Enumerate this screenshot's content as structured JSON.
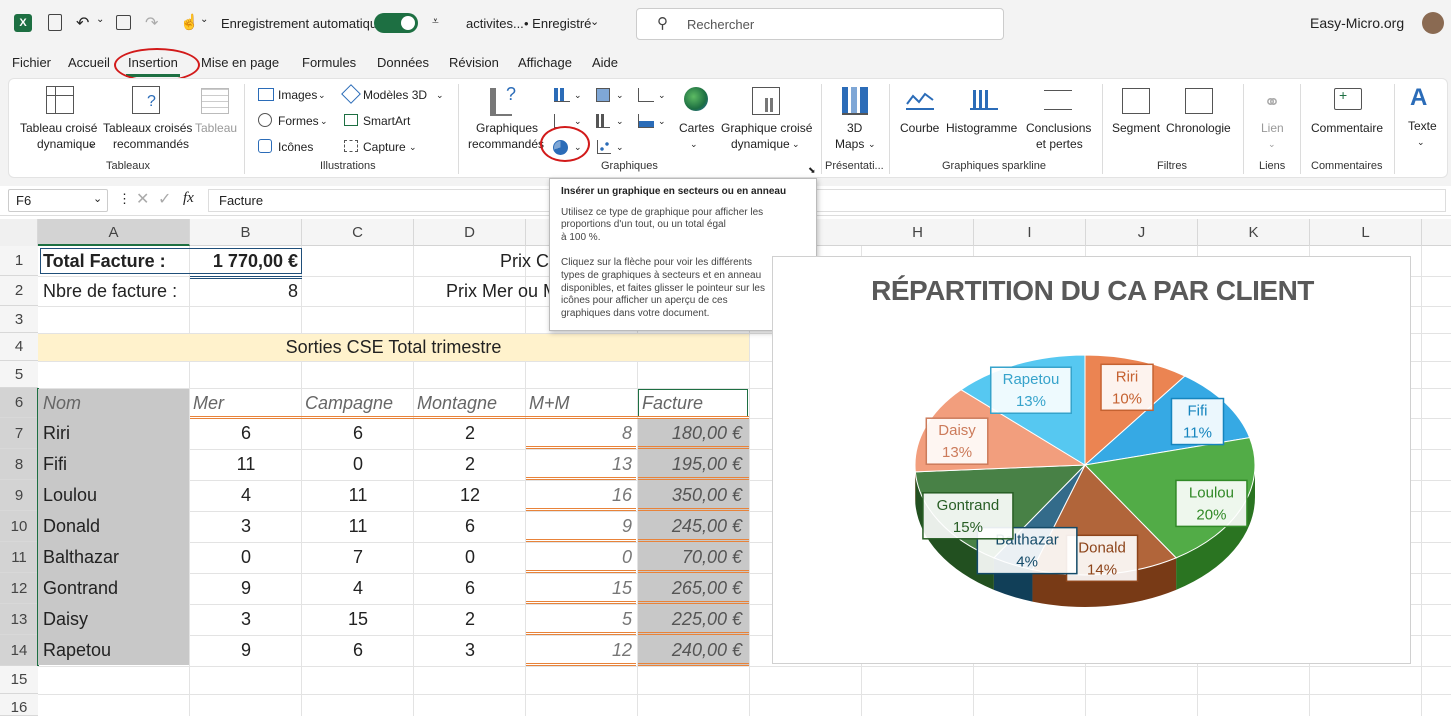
{
  "titlebar": {
    "autosave_label": "Enregistrement automatique",
    "filename": "activites...",
    "saved_status": "• Enregistré",
    "search_placeholder": "Rechercher",
    "site": "Easy-Micro.org"
  },
  "menu": [
    "Fichier",
    "Accueil",
    "Insertion",
    "Mise en page",
    "Formules",
    "Données",
    "Révision",
    "Affichage",
    "Aide"
  ],
  "ribbon": {
    "tableaux": {
      "group": "Tableaux",
      "btn1_line1": "Tableau croisé",
      "btn1_line2": "dynamique",
      "btn2_line1": "Tableaux croisés",
      "btn2_line2": "recommandés",
      "btn3": "Tableau"
    },
    "illustrations": {
      "group": "Illustrations",
      "images": "Images",
      "formes": "Formes",
      "icones": "Icônes",
      "modeles3d": "Modèles 3D",
      "smartart": "SmartArt",
      "capture": "Capture"
    },
    "graphiques": {
      "group": "Graphiques",
      "recommandes_line1": "Graphiques",
      "recommandes_line2": "recommandés",
      "cartes": "Cartes",
      "pivotchart_line1": "Graphique croisé",
      "pivotchart_line2": "dynamique"
    },
    "presentation": {
      "group": "Présentati...",
      "maps_line1": "3D",
      "maps_line2": "Maps"
    },
    "sparkline": {
      "group": "Graphiques sparkline",
      "courbe": "Courbe",
      "histogramme": "Histogramme",
      "conclusions_line1": "Conclusions",
      "conclusions_line2": "et pertes"
    },
    "filtres": {
      "group": "Filtres",
      "segment": "Segment",
      "chronologie": "Chronologie"
    },
    "liens": {
      "group": "Liens",
      "lien": "Lien"
    },
    "commentaires": {
      "group": "Commentaires",
      "commentaire": "Commentaire"
    },
    "texte": {
      "label": "Texte"
    }
  },
  "formula_bar": {
    "cell_ref": "F6",
    "fx": "fx",
    "value": "Facture"
  },
  "tooltip": {
    "title": "Insérer un graphique en secteurs ou en anneau",
    "p1_l1": "Utilisez ce type de graphique pour afficher les",
    "p1_l2": "proportions d'un tout, ou un total égal",
    "p1_l3": "à 100 %.",
    "p2_l1": "Cliquez sur la flèche pour voir les différents",
    "p2_l2": "types de graphiques à secteurs et en anneau",
    "p2_l3": "disponibles, et faites glisser le pointeur sur les",
    "p2_l4": "icônes pour afficher un aperçu de ces",
    "p2_l5": "graphiques dans votre document."
  },
  "columns": [
    "A",
    "B",
    "C",
    "D",
    "H",
    "I",
    "J",
    "K",
    "L"
  ],
  "rows": [
    "1",
    "2",
    "3",
    "4",
    "5",
    "6",
    "7",
    "8",
    "9",
    "10",
    "11",
    "12",
    "13",
    "14",
    "15",
    "16"
  ],
  "sheet": {
    "a1": "Total Facture :",
    "b1": "1 770,00 €",
    "d1": "Prix C",
    "a2": "Nbre de facture :",
    "b2": "8",
    "d2": "Prix Mer ou M",
    "a4_title": "Sorties CSE Total trimestre",
    "headers": [
      "Nom",
      "Mer",
      "Campagne",
      "Montagne",
      "M+M",
      "Facture"
    ],
    "table": [
      [
        "Riri",
        "6",
        "6",
        "2",
        "8",
        "180,00 €"
      ],
      [
        "Fifi",
        "11",
        "0",
        "2",
        "13",
        "195,00 €"
      ],
      [
        "Loulou",
        "4",
        "11",
        "12",
        "16",
        "350,00 €"
      ],
      [
        "Donald",
        "3",
        "11",
        "6",
        "9",
        "245,00 €"
      ],
      [
        "Balthazar",
        "0",
        "7",
        "0",
        "0",
        "70,00 €"
      ],
      [
        "Gontrand",
        "9",
        "4",
        "6",
        "15",
        "265,00 €"
      ],
      [
        "Daisy",
        "3",
        "15",
        "2",
        "5",
        "225,00 €"
      ],
      [
        "Rapetou",
        "9",
        "6",
        "3",
        "12",
        "240,00 €"
      ]
    ]
  },
  "chart_data": {
    "type": "pie",
    "title": "RÉPARTITION DU CA PAR CLIENT",
    "categories": [
      "Riri",
      "Fifi",
      "Loulou",
      "Donald",
      "Balthazar",
      "Gontrand",
      "Daisy",
      "Rapetou"
    ],
    "values": [
      10,
      11,
      20,
      14,
      4,
      15,
      13,
      13
    ],
    "labels": [
      "10%",
      "11%",
      "20%",
      "14%",
      "4%",
      "15%",
      "13%",
      "13%"
    ],
    "colors": [
      "#e8733a",
      "#1a9de0",
      "#3aa12e",
      "#a6501f",
      "#17577a",
      "#2f6f2c",
      "#f0916b",
      "#3fc0ef"
    ]
  }
}
